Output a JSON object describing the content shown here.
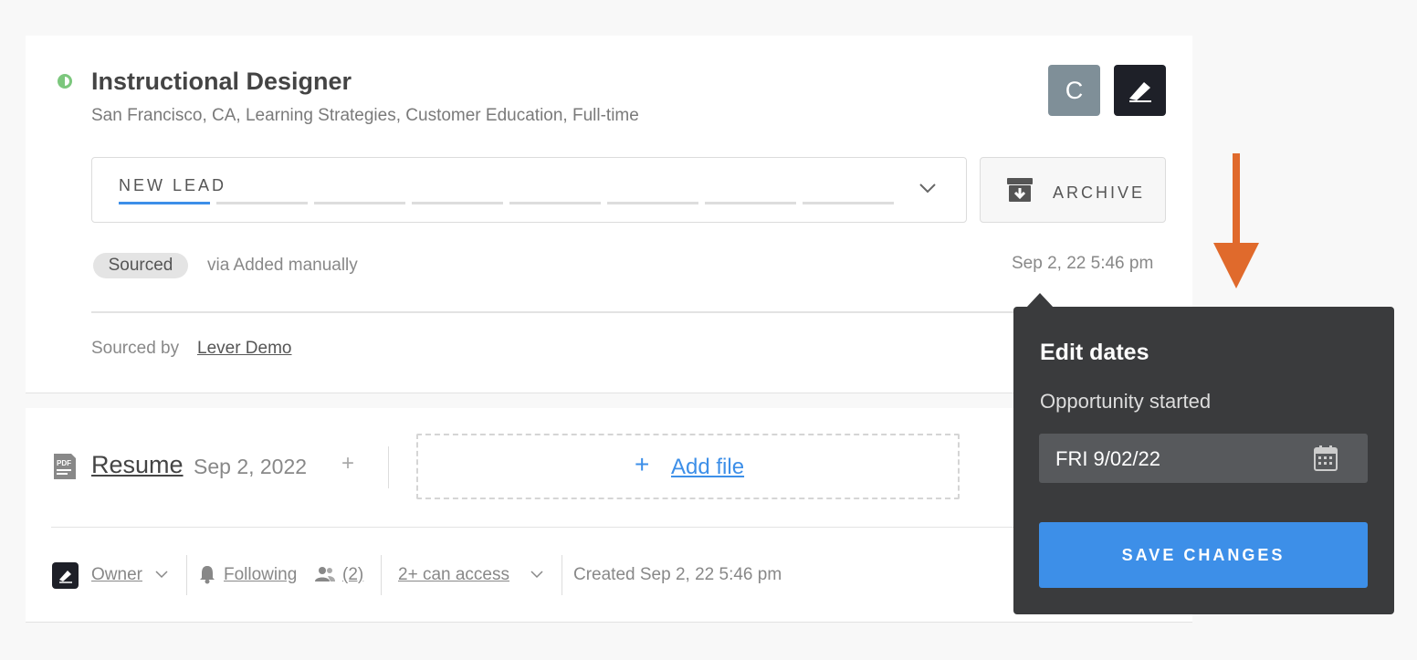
{
  "job": {
    "title": "Instructional Designer",
    "subtitle": "San Francisco, CA, Learning Strategies, Customer Education, Full-time",
    "avatar_initial": "C"
  },
  "stage": {
    "label": "NEW LEAD",
    "segments": 8,
    "active_segment": 1
  },
  "archive": {
    "label": "ARCHIVE"
  },
  "source": {
    "tag": "Sourced",
    "via": "via Added manually",
    "date": "Sep 2, 22 5:46 pm",
    "sourced_by_label": "Sourced by",
    "sourced_by_name": "Lever Demo"
  },
  "files": {
    "resume_label": "Resume",
    "resume_date": "Sep 2, 2022",
    "add_file_label": "Add file"
  },
  "footer": {
    "owner_label": "Owner",
    "following_label": "Following",
    "followers_count": "(2)",
    "access_label": "2+ can access",
    "created": "Created Sep 2, 22 5:46 pm"
  },
  "popover": {
    "title": "Edit dates",
    "field_label": "Opportunity started",
    "date_value": "FRI 9/02/22",
    "save_label": "SAVE CHANGES"
  },
  "colors": {
    "accent": "#3d8fe8",
    "status_green": "#7cc77d",
    "arrow": "#e06a2c",
    "popover_bg": "#3a3b3d"
  }
}
